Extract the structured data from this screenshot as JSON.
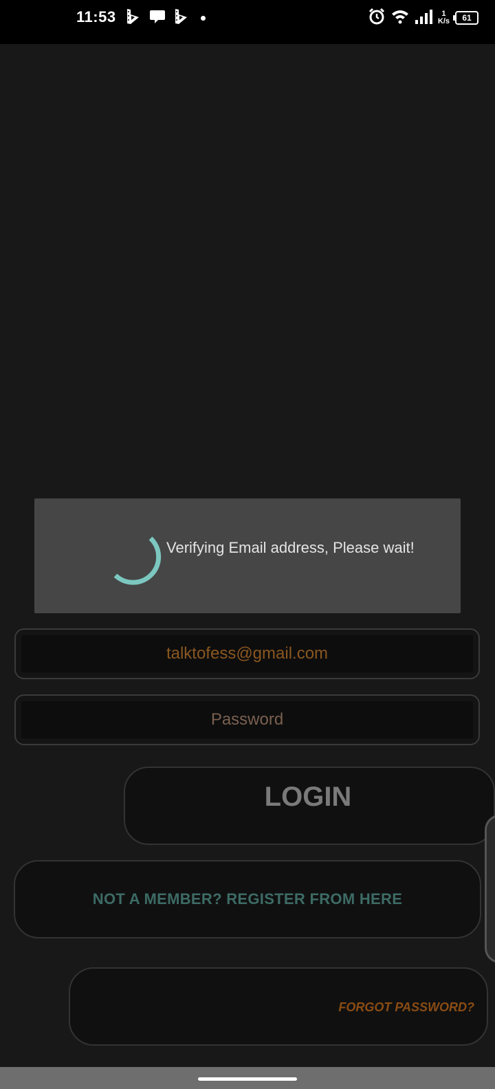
{
  "status_bar": {
    "time": "11:53",
    "net_speed_value": "1",
    "net_speed_unit": "K/s",
    "battery": "61",
    "left_icons": [
      "app-b-icon",
      "chat-bubble-icon",
      "app-b-icon",
      "notification-dot"
    ],
    "right_icons": [
      "alarm-icon",
      "wifi-icon",
      "signal-icon",
      "signal-icon",
      "battery-icon"
    ]
  },
  "dialog": {
    "message": "Verifying Email address, Please wait!",
    "spinner_color": "#7cc8c0"
  },
  "form": {
    "email_value": "talktofess@gmail.com",
    "password_placeholder": "Password",
    "login_label": "LOGIN",
    "register_label": "NOT A MEMBER?  REGISTER FROM HERE",
    "forgot_label": "FORGOT PASSWORD?"
  },
  "colors": {
    "background": "#181818",
    "dialog": "#464646",
    "email_text": "#8a5720",
    "register_text": "#3d6b65",
    "forgot_text": "#8a4c14"
  }
}
